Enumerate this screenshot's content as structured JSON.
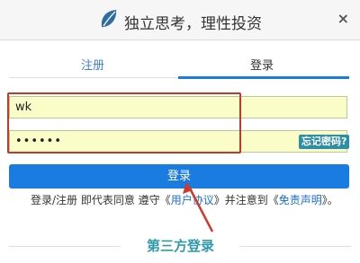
{
  "header": {
    "title": "独立思考，理性投资",
    "logo_icon": "leaf-logo-icon",
    "close_label": "×"
  },
  "tabs": {
    "register": "注册",
    "login": "登录",
    "active": "login"
  },
  "form": {
    "username_value": "wk",
    "password_value": "••••••",
    "forgot_label": "忘记密码?",
    "submit_label": "登录"
  },
  "agreement": {
    "prefix": "登录/注册 即代表同意 遵守《",
    "user_agreement": "用户协议",
    "middle": "》并注意到《",
    "disclaimer": "免责声明",
    "suffix": "》。"
  },
  "third_party": {
    "label": "第三方登录"
  },
  "colors": {
    "accent": "#1a7be0",
    "field_bg": "#fbfdc9",
    "annotation": "#c0392b",
    "forgot_bg": "#2e8ea5"
  }
}
